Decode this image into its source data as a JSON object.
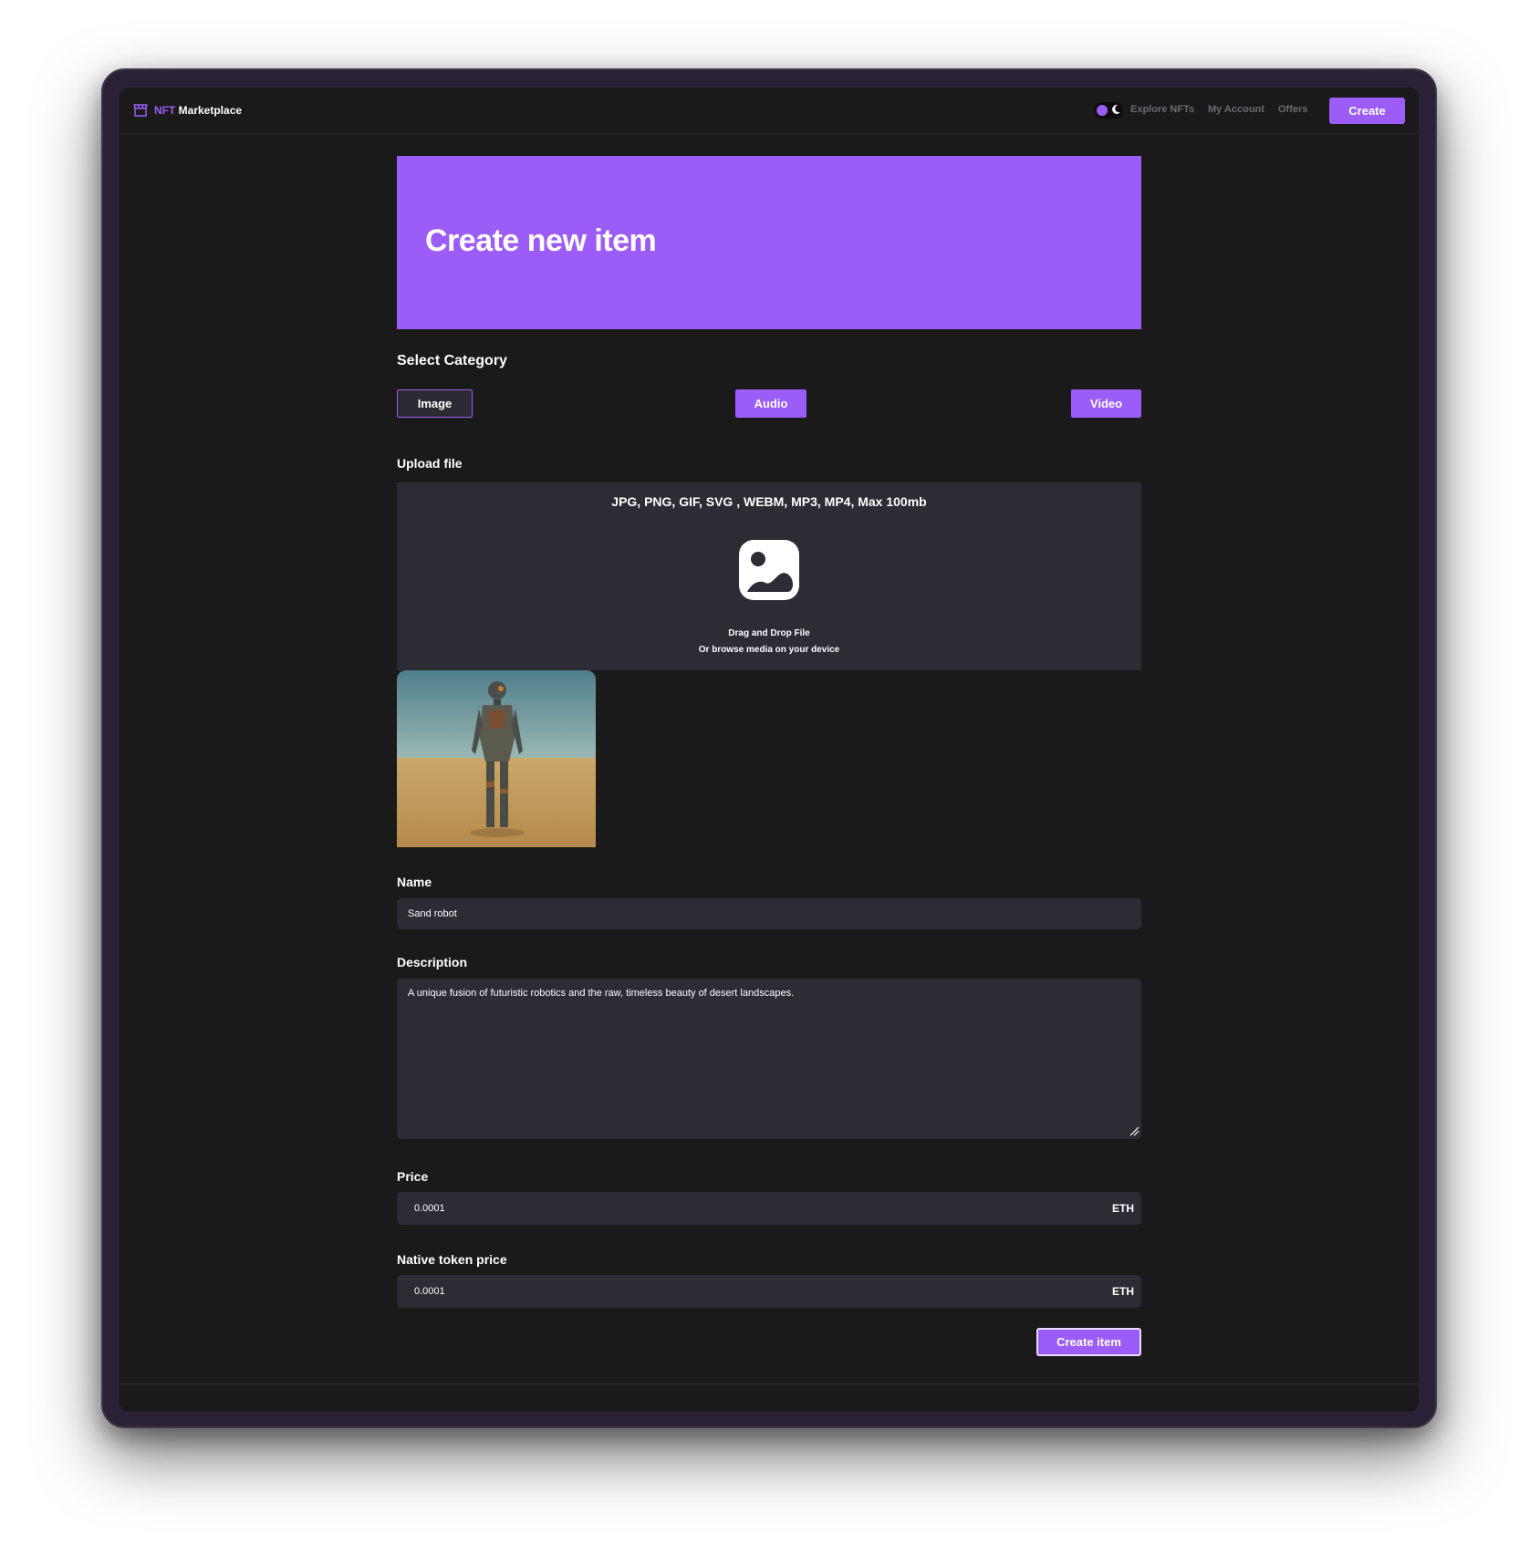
{
  "brand": {
    "prefix": "NFT",
    "name": "Marketplace"
  },
  "nav": {
    "links": [
      "Explore NFTs",
      "My Account",
      "Offers"
    ],
    "create_label": "Create"
  },
  "hero": {
    "title": "Create new item"
  },
  "category": {
    "title": "Select Category",
    "options": [
      "Image",
      "Audio",
      "Video"
    ],
    "selected": "Image"
  },
  "upload": {
    "label": "Upload file",
    "formats": "JPG, PNG, GIF, SVG , WEBM, MP3, MP4, Max 100mb",
    "drag_text": "Drag and Drop File",
    "browse_text": "Or browse media on your device"
  },
  "form": {
    "name_label": "Name",
    "name_value": "Sand robot",
    "description_label": "Description",
    "description_value": "A unique fusion of futuristic robotics and the raw, timeless beauty of desert landscapes.",
    "price_label": "Price",
    "price_value": "0.0001",
    "price_unit": "ETH",
    "native_label": "Native token price",
    "native_value": "0.0001",
    "native_unit": "ETH",
    "submit_label": "Create item"
  },
  "colors": {
    "accent": "#9b5cf7",
    "background": "#1a1a1b",
    "field": "#2c2c35"
  },
  "icons": [
    "store-icon",
    "moon-icon",
    "image-placeholder-icon"
  ]
}
